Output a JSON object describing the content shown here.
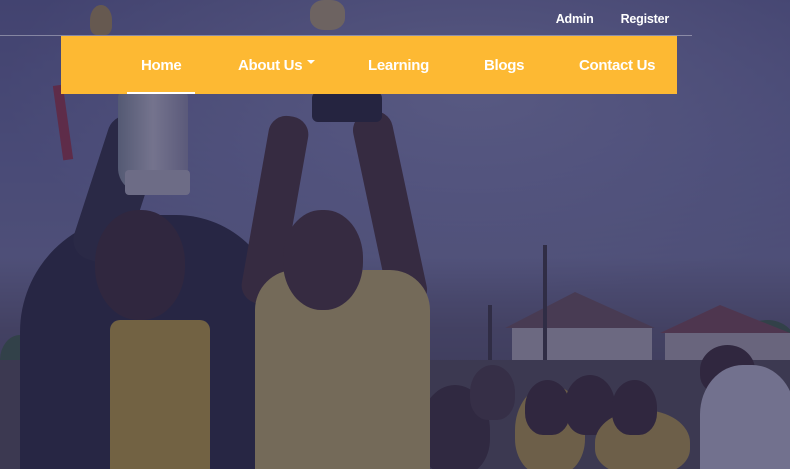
{
  "top_links": {
    "admin": "Admin",
    "register": "Register"
  },
  "nav": {
    "items": [
      {
        "label": "Home",
        "active": true
      },
      {
        "label": "About Us",
        "dropdown": true
      },
      {
        "label": "Learning"
      },
      {
        "label": "Blogs"
      },
      {
        "label": "Contact Us"
      }
    ]
  },
  "colors": {
    "nav_background": "#fdb933",
    "overlay": "#2a2852",
    "text": "#ffffff"
  }
}
